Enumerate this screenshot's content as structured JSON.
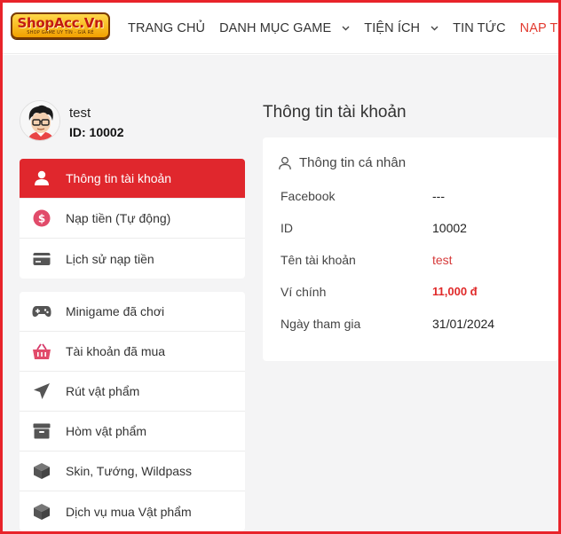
{
  "brand": {
    "logo_text": "ShopAcc.Vn",
    "logo_tagline": "SHOP GAME UY TÍN - GIÁ RẺ"
  },
  "nav": [
    {
      "label": "TRANG CHỦ",
      "dropdown": false,
      "active": false
    },
    {
      "label": "DANH MỤC GAME",
      "dropdown": true,
      "active": false
    },
    {
      "label": "TIỆN ÍCH",
      "dropdown": true,
      "active": false
    },
    {
      "label": "TIN TỨC",
      "dropdown": false,
      "active": false
    },
    {
      "label": "NẠP TIỀN",
      "dropdown": false,
      "active": true
    }
  ],
  "profile": {
    "name": "test",
    "id_text": "ID: 10002"
  },
  "menu_primary": [
    {
      "label": "Thông tin tài khoản",
      "icon": "user-icon",
      "active": true
    },
    {
      "label": "Nạp tiền (Tự động)",
      "icon": "dollar-coin-icon",
      "active": false
    },
    {
      "label": "Lịch sử nạp tiền",
      "icon": "credit-card-icon",
      "active": false
    }
  ],
  "menu_secondary": [
    {
      "label": "Minigame đã chơi",
      "icon": "gamepad-icon"
    },
    {
      "label": "Tài khoản đã mua",
      "icon": "shopping-basket-icon"
    },
    {
      "label": "Rút vật phẩm",
      "icon": "paper-plane-icon"
    },
    {
      "label": "Hòm vật phẩm",
      "icon": "archive-box-icon"
    },
    {
      "label": "Skin, Tướng, Wildpass",
      "icon": "cube-icon"
    },
    {
      "label": "Dịch vụ mua Vật phẩm",
      "icon": "cube-icon"
    }
  ],
  "main": {
    "title": "Thông tin tài khoản",
    "section_title": "Thông tin cá nhân",
    "rows": [
      {
        "label": "Facebook",
        "value": "---",
        "style": "normal"
      },
      {
        "label": "ID",
        "value": "10002",
        "style": "normal"
      },
      {
        "label": "Tên tài khoản",
        "value": "test",
        "style": "red"
      },
      {
        "label": "Ví chính",
        "value": "11,000 đ",
        "style": "bold-red"
      },
      {
        "label": "Ngày tham gia",
        "value": "31/01/2024",
        "style": "normal"
      }
    ]
  },
  "colors": {
    "accent": "#e0272d",
    "frame": "#e8232a",
    "nav_active": "#e23a2f",
    "value_red": "#d63a3a"
  }
}
